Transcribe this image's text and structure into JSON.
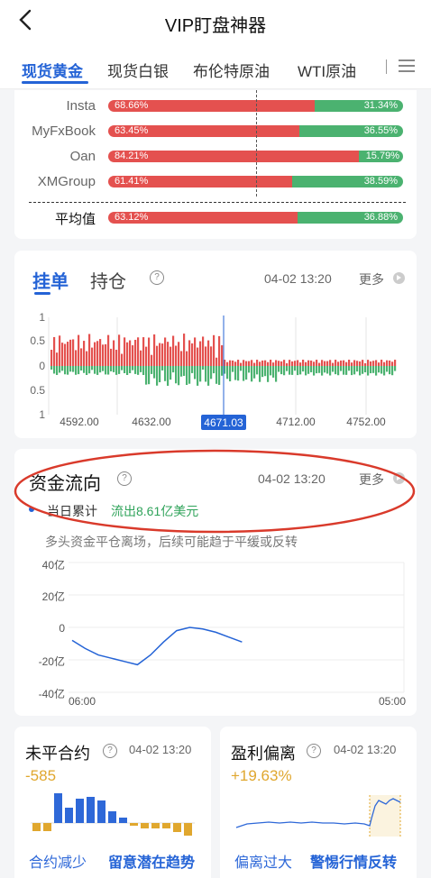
{
  "header": {
    "title": "VIP盯盘神器",
    "back_icon": "back-arrow-icon"
  },
  "tabs": [
    {
      "label": "现货黄金",
      "active": true
    },
    {
      "label": "现货白银"
    },
    {
      "label": "布伦特原油"
    },
    {
      "label": "WTI原油"
    },
    {
      "label": "I"
    }
  ],
  "sentiment": {
    "rows": [
      {
        "name": "Insta",
        "long": "68.66%",
        "short": "31.34%",
        "long_pct": 68.66
      },
      {
        "name": "MyFxBook",
        "long": "63.45%",
        "short": "36.55%",
        "long_pct": 63.45
      },
      {
        "name": "Oan",
        "long": "84.21%",
        "short": "15.79%",
        "long_pct": 84.21
      },
      {
        "name": "XMGroup",
        "long": "61.41%",
        "short": "38.59%",
        "long_pct": 61.41
      }
    ],
    "avg": {
      "name": "平均值",
      "long": "63.12%",
      "short": "36.88%",
      "long_pct": 63.12
    }
  },
  "orders": {
    "tab_active": "挂单",
    "tab_other": "持仓",
    "time": "04-02 13:20",
    "more": "更多",
    "y_ticks": [
      "1",
      "0.5",
      "0",
      "0.5",
      "1"
    ],
    "x_ticks": [
      "4592.00",
      "4632.00",
      "4671.03",
      "4712.00",
      "4752.00"
    ],
    "current_price": "4671.03"
  },
  "flow": {
    "title": "资金流向",
    "time": "04-02 13:20",
    "more": "更多",
    "legend_label": "当日累计",
    "legend_value": "流出8.61亿美元",
    "desc": "多头资金平仓离场，后续可能趋于平缓或反转",
    "y_ticks": [
      "40亿",
      "20亿",
      "0",
      "-20亿",
      "-40亿"
    ],
    "x_start": "06:00",
    "x_end": "05:00",
    "colors": {
      "legend_dot": "#2463d6",
      "outflow": "#2fa35a",
      "line": "#2463d6"
    }
  },
  "open_interest": {
    "title": "未平合约",
    "time": "04-02 13:20",
    "value": "-585",
    "foot1": "合约减少",
    "foot2": "留意潜在趋势"
  },
  "profit": {
    "title": "盈利偏离",
    "time": "04-02 13:20",
    "value": "+19.63%",
    "foot1": "偏离过大",
    "foot2": "警惕行情反转"
  },
  "chart_data": [
    {
      "type": "line",
      "title": "资金流向",
      "ylim": [
        -40,
        40
      ],
      "x": [
        "06:00",
        "",
        "",
        "",
        "",
        "",
        "",
        "",
        "",
        "",
        "",
        "",
        "",
        "",
        "",
        "",
        "05:00"
      ],
      "series": [
        {
          "values": [
            -8,
            -13,
            -17,
            -19,
            -21,
            -23,
            -17,
            -9,
            -2,
            0,
            -1,
            -3,
            -6,
            -9,
            null,
            null,
            null
          ]
        }
      ]
    }
  ]
}
